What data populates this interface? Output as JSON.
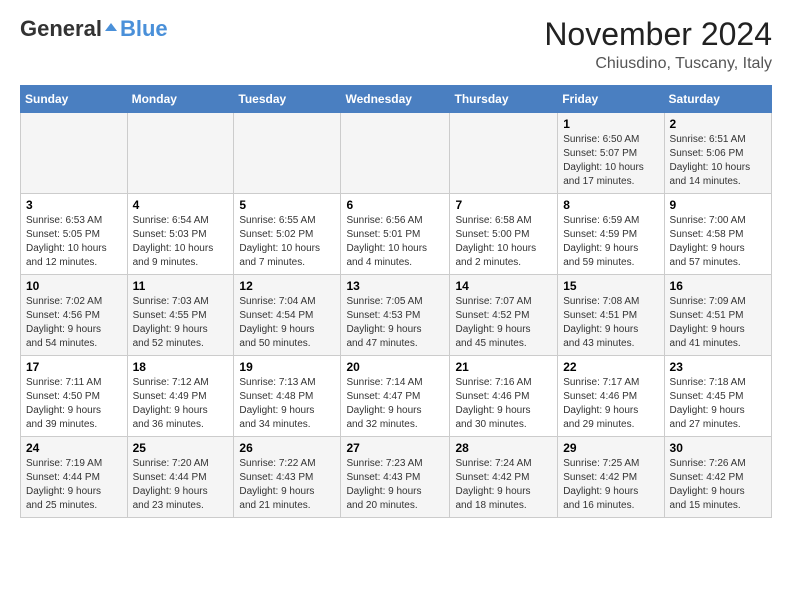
{
  "logo": {
    "general": "General",
    "blue": "Blue"
  },
  "title": "November 2024",
  "location": "Chiusdino, Tuscany, Italy",
  "headers": [
    "Sunday",
    "Monday",
    "Tuesday",
    "Wednesday",
    "Thursday",
    "Friday",
    "Saturday"
  ],
  "weeks": [
    [
      {
        "day": "",
        "info": ""
      },
      {
        "day": "",
        "info": ""
      },
      {
        "day": "",
        "info": ""
      },
      {
        "day": "",
        "info": ""
      },
      {
        "day": "",
        "info": ""
      },
      {
        "day": "1",
        "info": "Sunrise: 6:50 AM\nSunset: 5:07 PM\nDaylight: 10 hours\nand 17 minutes."
      },
      {
        "day": "2",
        "info": "Sunrise: 6:51 AM\nSunset: 5:06 PM\nDaylight: 10 hours\nand 14 minutes."
      }
    ],
    [
      {
        "day": "3",
        "info": "Sunrise: 6:53 AM\nSunset: 5:05 PM\nDaylight: 10 hours\nand 12 minutes."
      },
      {
        "day": "4",
        "info": "Sunrise: 6:54 AM\nSunset: 5:03 PM\nDaylight: 10 hours\nand 9 minutes."
      },
      {
        "day": "5",
        "info": "Sunrise: 6:55 AM\nSunset: 5:02 PM\nDaylight: 10 hours\nand 7 minutes."
      },
      {
        "day": "6",
        "info": "Sunrise: 6:56 AM\nSunset: 5:01 PM\nDaylight: 10 hours\nand 4 minutes."
      },
      {
        "day": "7",
        "info": "Sunrise: 6:58 AM\nSunset: 5:00 PM\nDaylight: 10 hours\nand 2 minutes."
      },
      {
        "day": "8",
        "info": "Sunrise: 6:59 AM\nSunset: 4:59 PM\nDaylight: 9 hours\nand 59 minutes."
      },
      {
        "day": "9",
        "info": "Sunrise: 7:00 AM\nSunset: 4:58 PM\nDaylight: 9 hours\nand 57 minutes."
      }
    ],
    [
      {
        "day": "10",
        "info": "Sunrise: 7:02 AM\nSunset: 4:56 PM\nDaylight: 9 hours\nand 54 minutes."
      },
      {
        "day": "11",
        "info": "Sunrise: 7:03 AM\nSunset: 4:55 PM\nDaylight: 9 hours\nand 52 minutes."
      },
      {
        "day": "12",
        "info": "Sunrise: 7:04 AM\nSunset: 4:54 PM\nDaylight: 9 hours\nand 50 minutes."
      },
      {
        "day": "13",
        "info": "Sunrise: 7:05 AM\nSunset: 4:53 PM\nDaylight: 9 hours\nand 47 minutes."
      },
      {
        "day": "14",
        "info": "Sunrise: 7:07 AM\nSunset: 4:52 PM\nDaylight: 9 hours\nand 45 minutes."
      },
      {
        "day": "15",
        "info": "Sunrise: 7:08 AM\nSunset: 4:51 PM\nDaylight: 9 hours\nand 43 minutes."
      },
      {
        "day": "16",
        "info": "Sunrise: 7:09 AM\nSunset: 4:51 PM\nDaylight: 9 hours\nand 41 minutes."
      }
    ],
    [
      {
        "day": "17",
        "info": "Sunrise: 7:11 AM\nSunset: 4:50 PM\nDaylight: 9 hours\nand 39 minutes."
      },
      {
        "day": "18",
        "info": "Sunrise: 7:12 AM\nSunset: 4:49 PM\nDaylight: 9 hours\nand 36 minutes."
      },
      {
        "day": "19",
        "info": "Sunrise: 7:13 AM\nSunset: 4:48 PM\nDaylight: 9 hours\nand 34 minutes."
      },
      {
        "day": "20",
        "info": "Sunrise: 7:14 AM\nSunset: 4:47 PM\nDaylight: 9 hours\nand 32 minutes."
      },
      {
        "day": "21",
        "info": "Sunrise: 7:16 AM\nSunset: 4:46 PM\nDaylight: 9 hours\nand 30 minutes."
      },
      {
        "day": "22",
        "info": "Sunrise: 7:17 AM\nSunset: 4:46 PM\nDaylight: 9 hours\nand 29 minutes."
      },
      {
        "day": "23",
        "info": "Sunrise: 7:18 AM\nSunset: 4:45 PM\nDaylight: 9 hours\nand 27 minutes."
      }
    ],
    [
      {
        "day": "24",
        "info": "Sunrise: 7:19 AM\nSunset: 4:44 PM\nDaylight: 9 hours\nand 25 minutes."
      },
      {
        "day": "25",
        "info": "Sunrise: 7:20 AM\nSunset: 4:44 PM\nDaylight: 9 hours\nand 23 minutes."
      },
      {
        "day": "26",
        "info": "Sunrise: 7:22 AM\nSunset: 4:43 PM\nDaylight: 9 hours\nand 21 minutes."
      },
      {
        "day": "27",
        "info": "Sunrise: 7:23 AM\nSunset: 4:43 PM\nDaylight: 9 hours\nand 20 minutes."
      },
      {
        "day": "28",
        "info": "Sunrise: 7:24 AM\nSunset: 4:42 PM\nDaylight: 9 hours\nand 18 minutes."
      },
      {
        "day": "29",
        "info": "Sunrise: 7:25 AM\nSunset: 4:42 PM\nDaylight: 9 hours\nand 16 minutes."
      },
      {
        "day": "30",
        "info": "Sunrise: 7:26 AM\nSunset: 4:42 PM\nDaylight: 9 hours\nand 15 minutes."
      }
    ]
  ]
}
